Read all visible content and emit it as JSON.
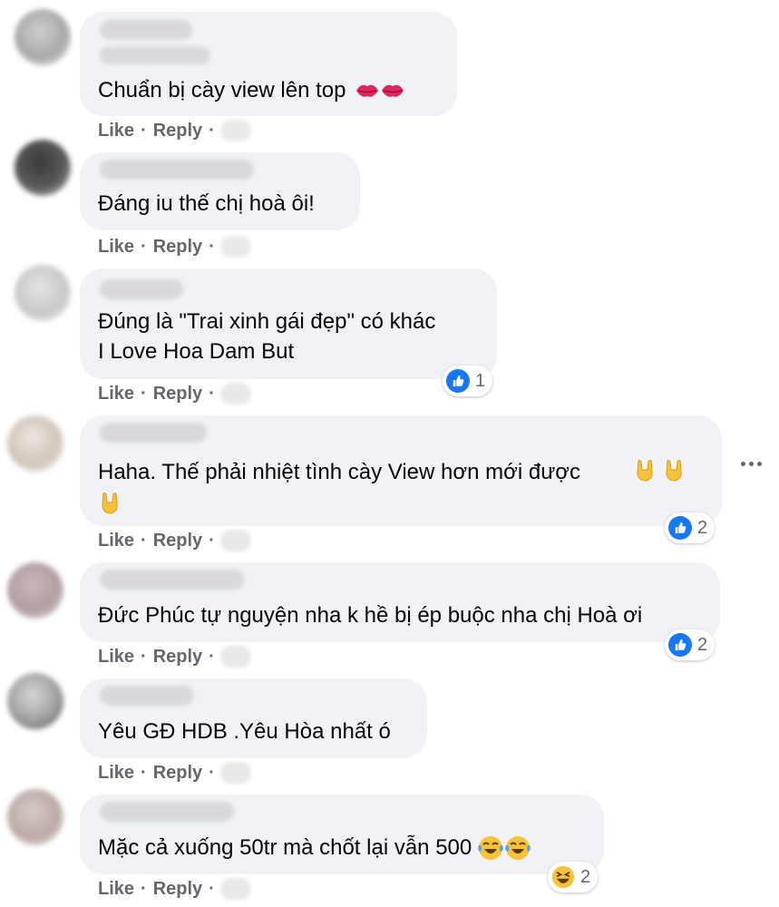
{
  "actions": {
    "like": "Like",
    "reply": "Reply",
    "separator": "·"
  },
  "comments": [
    {
      "text": "Chuẩn bị cày view lên top",
      "emojis": [
        "kissing-lips",
        "kissing-lips"
      ]
    },
    {
      "text": "Đáng iu thế chị hoà ôi!"
    },
    {
      "text": "Đúng là \"Trai xinh gái đẹp\" có khác\nI Love Hoa Dam But",
      "reaction": {
        "type": "like",
        "count": "1"
      }
    },
    {
      "text": "Haha. Thế phải nhiệt tình cày View hơn mới được",
      "emojis": [
        "sign-of-the-horns",
        "sign-of-the-horns",
        "sign-of-the-horns"
      ],
      "reaction": {
        "type": "like",
        "count": "2"
      }
    },
    {
      "text": "Đức Phúc tự nguyện nha k hề bị ép buộc nha chị Hoà ơi",
      "reaction": {
        "type": "like",
        "count": "2"
      }
    },
    {
      "text": "Yêu GĐ HDB .Yêu Hòa nhất ó"
    },
    {
      "text": "Mặc cả xuống 50tr mà chốt lại vẫn 500",
      "emojis": [
        "tears-of-joy",
        "tears-of-joy"
      ],
      "reaction": {
        "type": "haha",
        "count": "2"
      }
    }
  ],
  "colors": {
    "bubble": "#f0f2f5",
    "action_text": "#65676b",
    "like_blue": "#1877f2"
  },
  "icons": {
    "more_options": "more-horizontal-icon"
  }
}
